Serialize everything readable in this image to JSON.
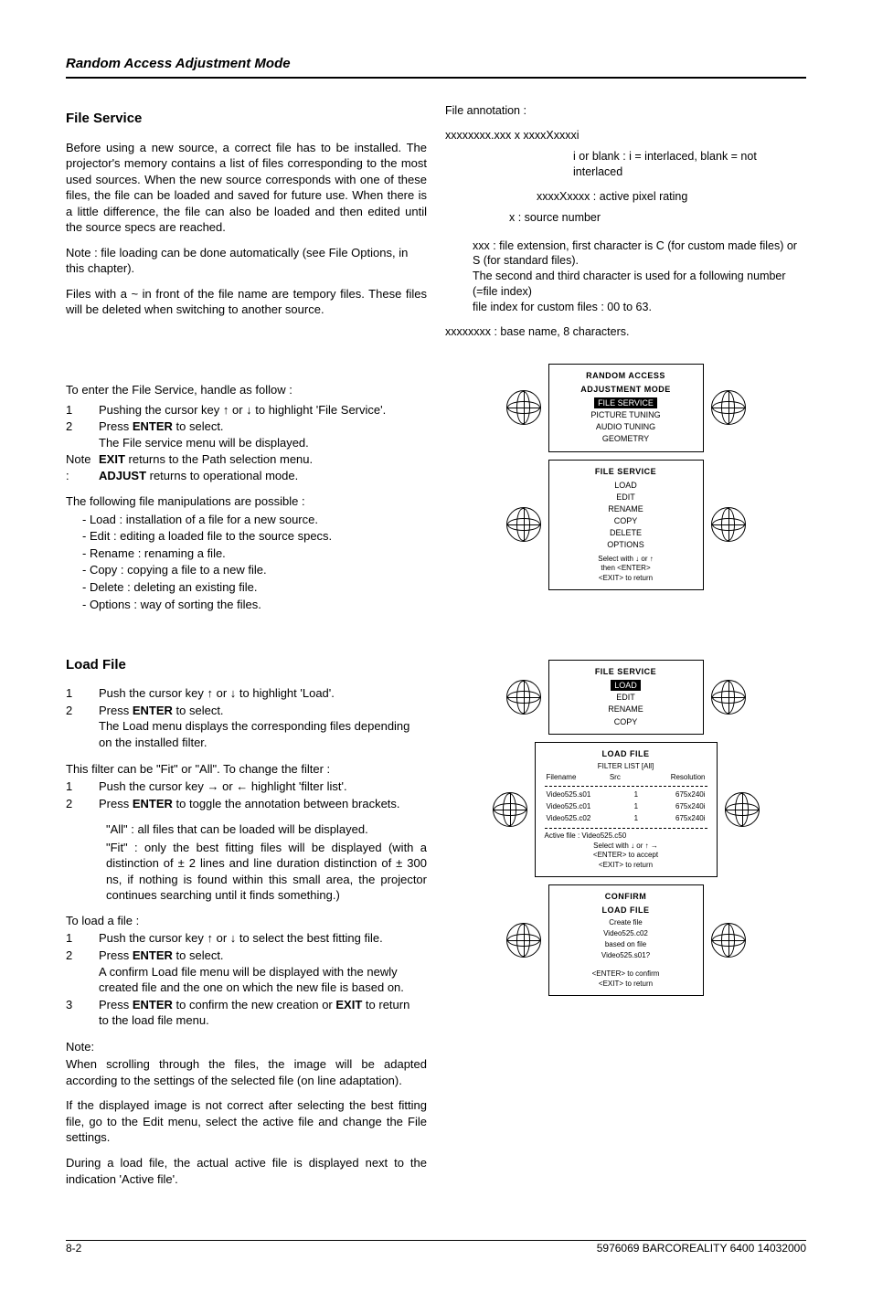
{
  "chapter_title": "Random Access Adjustment Mode",
  "section1": {
    "title": "File Service",
    "p1": "Before using a new source, a correct file has to be installed.  The projector's memory contains a list of files corresponding to the most used sources.  When the new source corresponds with one of these files, the file can be loaded and saved for future use.  When there is a little difference, the file can also be loaded and then edited until the source specs are reached.",
    "note1": "Note : file loading can be done automatically (see File Options, in this chapter).",
    "note2": "Files with a ~ in front of the file name are tempory files.  These files will be deleted when switching to another source.",
    "enter_title": "To enter the File Service, handle as follow :",
    "step1_n": "1",
    "step1": "Pushing the cursor key ↑ or ↓ to highlight 'File Service'.",
    "step2_n": "2",
    "step2a": "Press ",
    "step2b": "ENTER",
    "step2c": " to select.",
    "step2_sub": "The File service menu will be displayed.",
    "note3_label": "Note :",
    "note3a": "EXIT",
    "note3b": " returns to the Path selection menu.",
    "note3c": "ADJUST",
    "note3d": " returns to operational mode.",
    "manip_title": "The following file manipulations are possible :",
    "m1": "- Load : installation of a file for a new source.",
    "m2": "- Edit : editing a loaded file to the source specs.",
    "m3": "- Rename : renaming a file.",
    "m4": "- Copy : copying a file to a new file.",
    "m5": "- Delete :  deleting an existing file.",
    "m6": "- Options : way of sorting the files."
  },
  "annotation": {
    "label": "File annotation :",
    "pattern": "xxxxxxxx.xxx    x    xxxxXxxxxi",
    "i_line": "i or blank : i = interlaced, blank = not interlaced",
    "pixrating": "xxxxXxxxx : active pixel rating",
    "srcnum": "x : source number",
    "ext1": "xxx : file extension, first character is C (for custom made files) or S (for standard files).",
    "ext2": "The second and third character is used for a following number (=file index)",
    "ext3": "file index for custom files : 00 to 63.",
    "base": "xxxxxxxx : base name,  8 characters."
  },
  "osd1": {
    "title1": "RANDOM ACCESS",
    "title2": "ADJUSTMENT MODE",
    "i1": "FILE SERVICE",
    "i2": "PICTURE TUNING",
    "i3": "AUDIO TUNING",
    "i4": "GEOMETRY"
  },
  "osd2": {
    "title": "FILE SERVICE",
    "i1": "LOAD",
    "i2": "EDIT",
    "i3": "RENAME",
    "i4": "COPY",
    "i5": "DELETE",
    "i6": "OPTIONS",
    "s1": "Select with  ↓  or ↑",
    "s2": "then <ENTER>",
    "s3": "<EXIT> to return"
  },
  "section2": {
    "title": "Load File",
    "s1n": "1",
    "s1": "Push the cursor key ↑ or ↓ to highlight 'Load'.",
    "s2n": "2",
    "s2a": "Press ",
    "s2b": "ENTER",
    "s2c": " to select.",
    "s2sub": "The Load menu displays the corresponding files depending on the installed filter.",
    "filter_intro": "This filter can be \"Fit\" or \"All\".  To change the filter :",
    "f1n": "1",
    "f1": "Push the cursor key → or ← highlight 'filter list'.",
    "f2n": "2",
    "f2a": "Press ",
    "f2b": "ENTER",
    "f2c": " to toggle the annotation between brackets.",
    "all_desc": "\"All\" : all files that can be loaded will be displayed.",
    "fit_desc": "\"Fit\" : only the best fitting files will  be displayed (with a distinction of ± 2 lines and line duration distinction of ± 300 ns, if nothing is found within this small area, the projector continues searching until it finds something.)",
    "load_title": "To load a file :",
    "l1n": "1",
    "l1": "Push the cursor key ↑ or ↓ to select the best fitting file.",
    "l2n": "2",
    "l2a": "Press ",
    "l2b": "ENTER",
    "l2c": " to select.",
    "l2sub": "A confirm Load file menu will be displayed with the newly created file and the one on which the new file is based on.",
    "l3n": "3",
    "l3a": "Press ",
    "l3b": "ENTER",
    "l3c": " to confirm the new creation or ",
    "l3d": "EXIT",
    "l3e": " to return to the load file menu.",
    "note_label": "Note:",
    "note_p1": "When scrolling through the files, the image will be adapted according to the settings of the selected file (on line adaptation).",
    "note_p2": "If the displayed image is not correct after selecting the best fitting file, go to the Edit menu, select the active file and change the File settings.",
    "note_p3": "During a load file, the actual active file is displayed next to the indication 'Active file'."
  },
  "osd3": {
    "title": "FILE SERVICE",
    "i1": "LOAD",
    "i2": "EDIT",
    "i3": "RENAME",
    "i4": "COPY"
  },
  "osd4": {
    "title": "LOAD FILE",
    "filter": "FILTER LIST [All]",
    "h1": "Filename",
    "h2": "Src",
    "h3": "Resolution",
    "r1a": "Video525.s01",
    "r1b": "1",
    "r1c": "675x240i",
    "r2a": "Video525.c01",
    "r2b": "1",
    "r2c": "675x240i",
    "r3a": "Video525.c02",
    "r3b": "1",
    "r3c": "675x240i",
    "active": "Active file : Video525.c50",
    "s1": "Select with ↓ or ↑ →",
    "s2": "<ENTER> to accept",
    "s3": "<EXIT> to return"
  },
  "osd5": {
    "title1": "CONFIRM",
    "title2": "LOAD FILE",
    "l1": "Create file",
    "l2": "Video525.c02",
    "l3": "based on file",
    "l4": "Video525.s01?",
    "s1": "<ENTER> to confirm",
    "s2": "<EXIT> to return"
  },
  "footer": {
    "left": "8-2",
    "right": "5976069 BARCOREALITY 6400 14032000"
  }
}
